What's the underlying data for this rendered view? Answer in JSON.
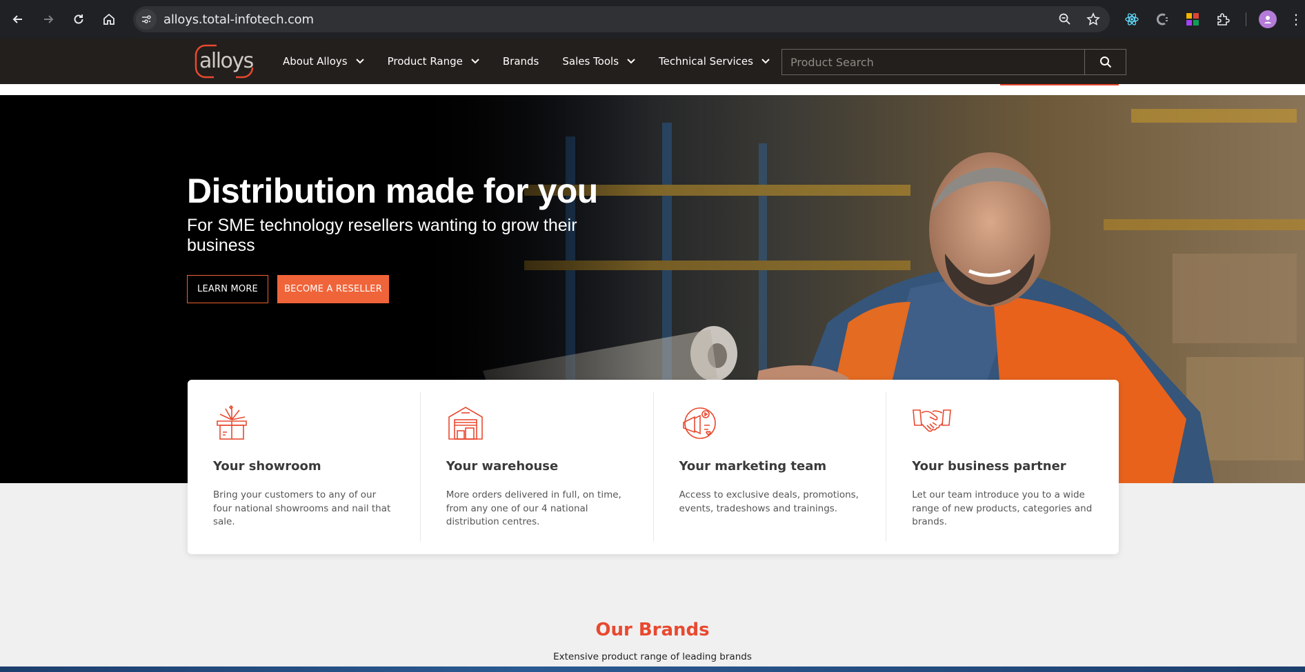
{
  "browser": {
    "url": "alloys.total-infotech.com"
  },
  "header": {
    "logo_text": "alloys",
    "nav": [
      {
        "label": "About Alloys",
        "has_dropdown": true
      },
      {
        "label": "Product Range",
        "has_dropdown": true
      },
      {
        "label": "Brands",
        "has_dropdown": false
      },
      {
        "label": "Sales Tools",
        "has_dropdown": true
      },
      {
        "label": "Technical Services",
        "has_dropdown": true
      }
    ],
    "search_placeholder": "Product Search"
  },
  "hero": {
    "title": "Distribution made for you",
    "subtitle": "For SME technology resellers wanting to grow their business",
    "learn_more": "LEARN MORE",
    "become_reseller": "BECOME A RESELLER"
  },
  "features": [
    {
      "icon": "showroom-icon",
      "title": "Your showroom",
      "text": "Bring your customers to any of our four national showrooms and nail that sale."
    },
    {
      "icon": "warehouse-icon",
      "title": "Your warehouse",
      "text": "More orders delivered in full, on time, from any one of our 4 national distribution centres."
    },
    {
      "icon": "marketing-icon",
      "title": "Your marketing team",
      "text": "Access to exclusive deals, promotions, events, tradeshows and trainings."
    },
    {
      "icon": "handshake-icon",
      "title": "Your business partner",
      "text": "Let our team introduce you to a wide range of new products, categories and brands."
    }
  ],
  "brands": {
    "title": "Our Brands",
    "subtitle": "Extensive product range of leading brands"
  },
  "colors": {
    "accent": "#f0643a",
    "header_bg": "#231f1c",
    "brand_red": "#e8492f"
  }
}
